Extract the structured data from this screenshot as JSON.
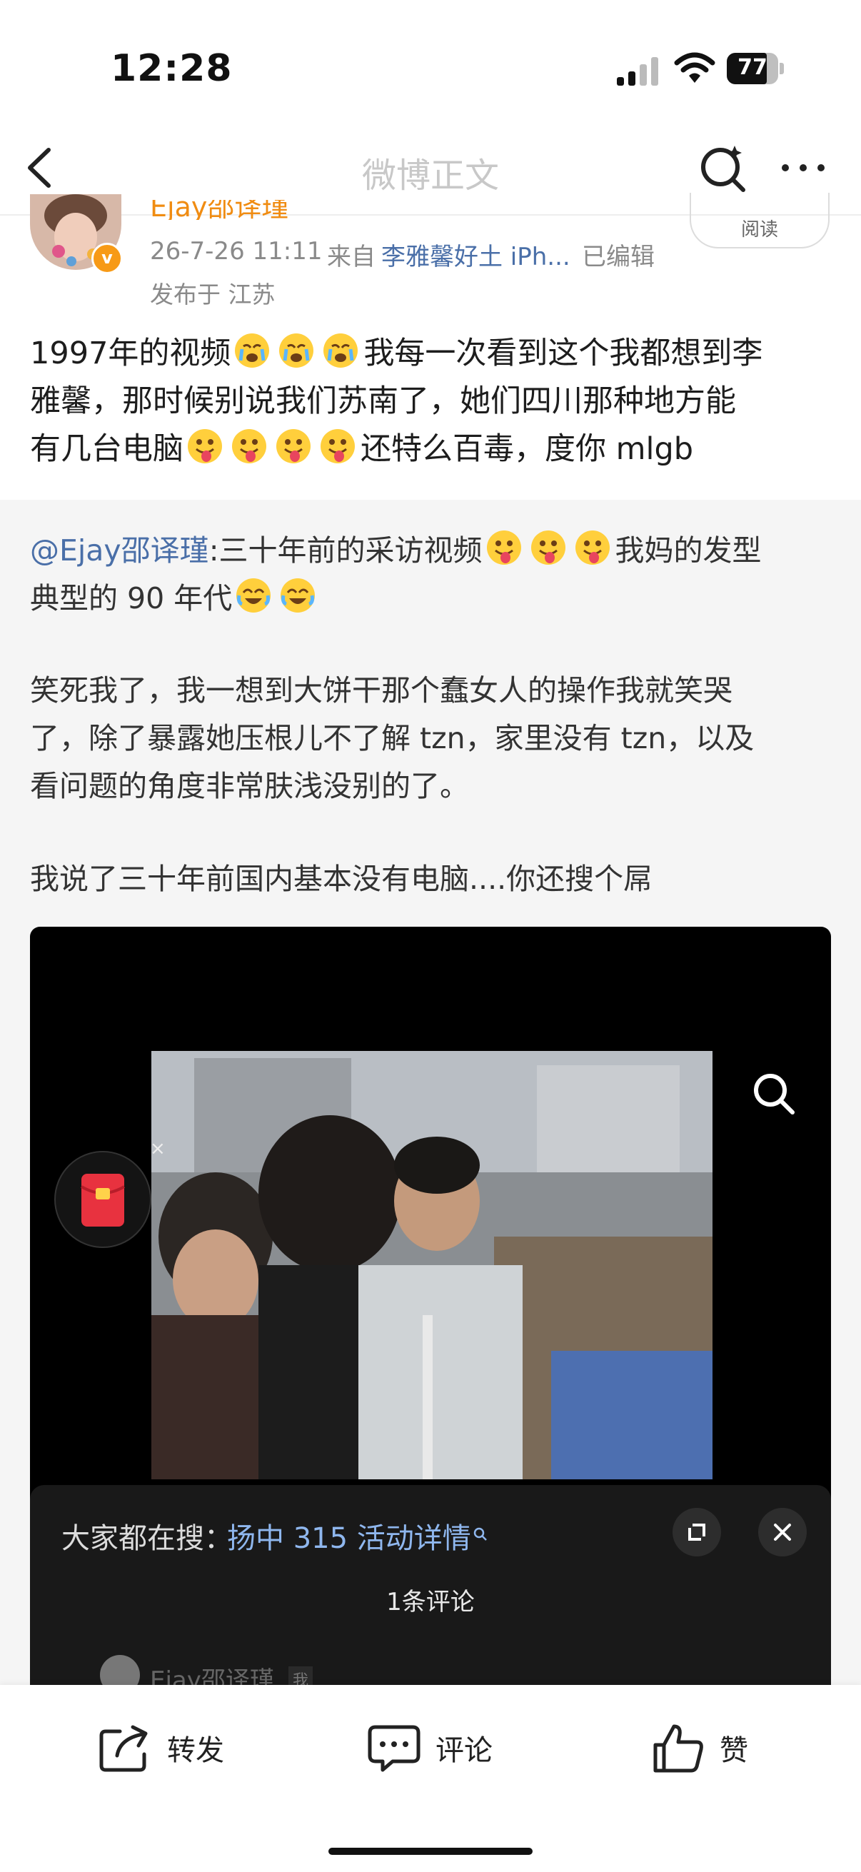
{
  "status_bar": {
    "time": "12:28",
    "battery": "77"
  },
  "nav": {
    "title": "微博正文"
  },
  "post": {
    "time": "26-7-26 11:11",
    "from_label": "来自",
    "device": "李雅馨好土 iPh...",
    "edited": "已编辑",
    "location": "发布于 江苏",
    "read_label": "阅读",
    "text_line1": "1997年的视频",
    "text_line1b": "我每一次看到这个我都想到李",
    "text_line2": "雅馨，那时候别说我们苏南了，她们四川那种地方能",
    "text_line3a": "有几台电脑",
    "text_line3b": "还特么百毒，度你 mlgb"
  },
  "repost": {
    "mention": "@Ejay邵译瑾",
    "line1": ":三十年前的采访视频",
    "line1b": "我妈的发型",
    "line2": "典型的 90 年代",
    "para2_line1": "笑死我了，我一想到大饼干那个蠢女人的操作我就笑哭",
    "para2_line2": "了，除了暴露她压根儿不了解 tzn，家里没有 tzn，以及",
    "para2_line3": "看问题的角度非常肤浅没别的了。",
    "para3": "我说了三十年前国内基本没有电脑....你还搜个屌"
  },
  "video": {
    "hot_prefix": "大家都在搜：",
    "hot_topic": "扬中 315 活动详情",
    "comment_count": "1条评论",
    "commenter": "Ejay邵译瑾",
    "commenter_tag": "我",
    "redpacket_close": "×"
  },
  "actions": {
    "repost": "转发",
    "comment": "评论",
    "like": "赞"
  },
  "colors": {
    "link": "#4a6fa8",
    "username": "#f08c12",
    "hot_topic": "#8fb7ee"
  }
}
